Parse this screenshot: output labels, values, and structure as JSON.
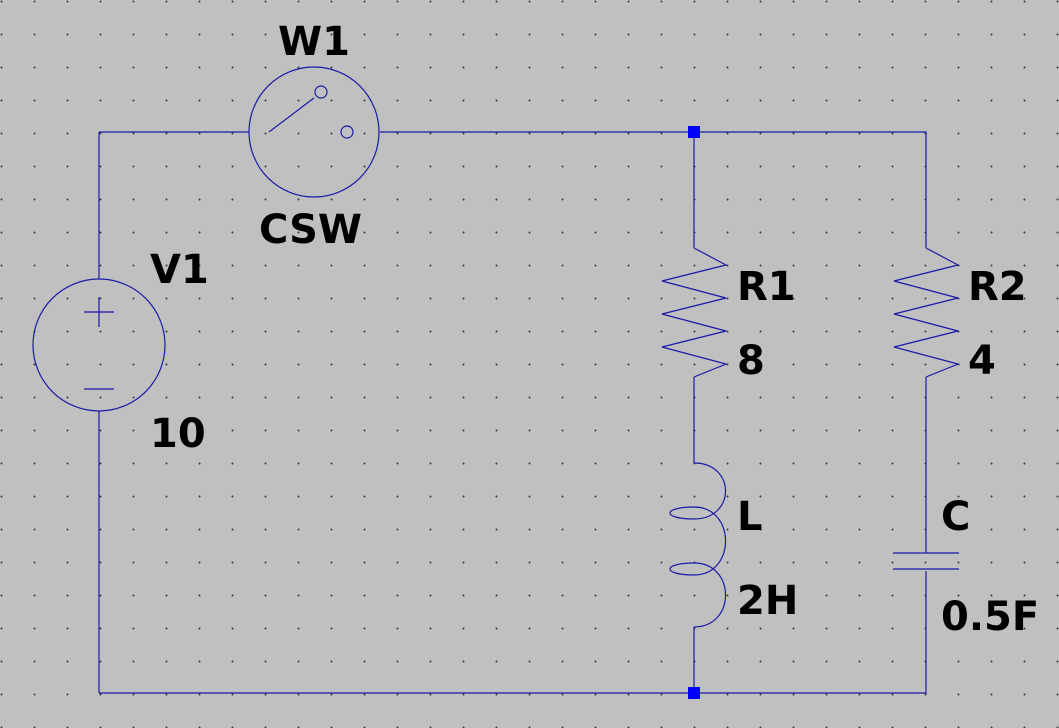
{
  "colors": {
    "background": "#c0c0c0",
    "wire": "#1a1aa6",
    "node": "#0000ff",
    "text": "#000000",
    "grid_dot": "#404040"
  },
  "components": {
    "switch": {
      "name": "W1",
      "model": "CSW"
    },
    "source": {
      "name": "V1",
      "value": "10"
    },
    "r1": {
      "name": "R1",
      "value": "8"
    },
    "r2": {
      "name": "R2",
      "value": "4"
    },
    "inductor": {
      "name": "L",
      "value": "2H"
    },
    "capacitor": {
      "name": "C",
      "value": "0.5F"
    }
  }
}
